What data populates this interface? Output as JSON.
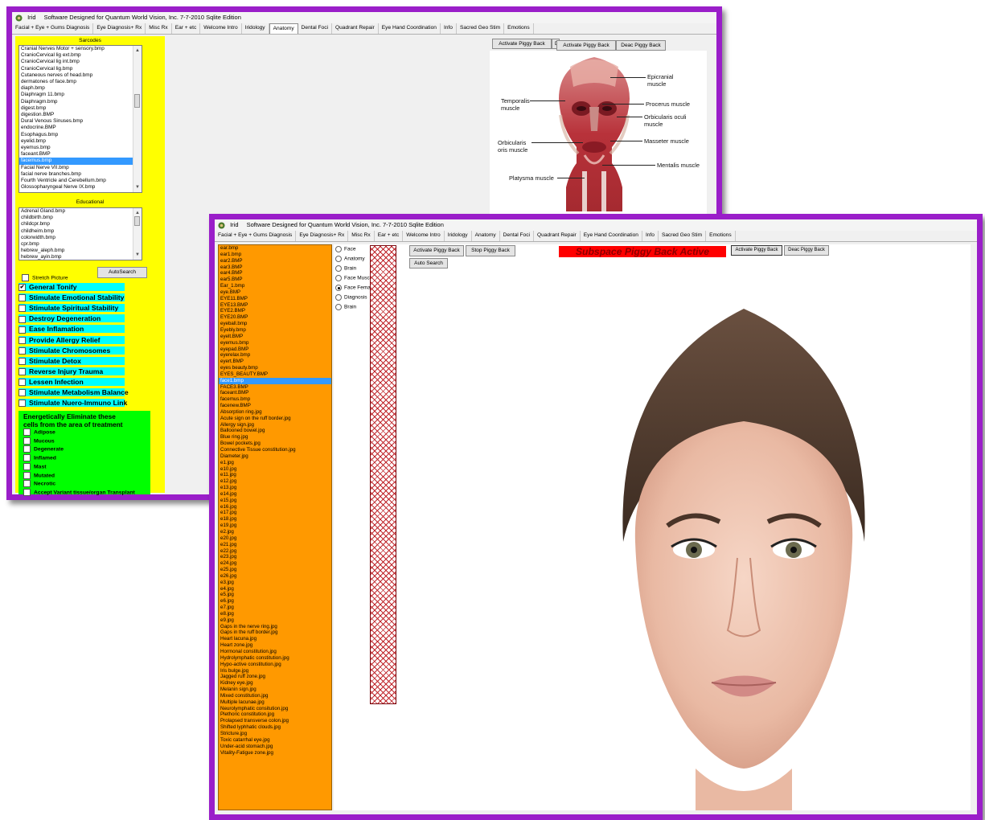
{
  "win1": {
    "title": "Software Designed for Quantum World Vision, Inc. 7-7-2010 Sqlite Edition",
    "app": "Irid",
    "tabs": [
      "Facial + Eye + Gums Diagnosis",
      "Eye Diagnosis+ Rx",
      "Misc Rx",
      "Ear + etc",
      "Welcome Intro",
      "Iridology",
      "Anatomy",
      "Dental Foci",
      "Quadrant Repair",
      "Eye Hand Coordination",
      "Info",
      "Sacred Geo Stim",
      "Emotions"
    ],
    "active_tab": "Anatomy",
    "sarcodes_label": "Sarcodes",
    "sarcodes": [
      "Cranial Nerves Motor + sensory.bmp",
      "CranioCervical lig ext.bmp",
      "CranioCervical lig int.bmp",
      "CranioCervical lig.bmp",
      "Cutaneous nerves of head.bmp",
      "dermatones of face.bmp",
      "diaph.bmp",
      "Diaphragm 11.bmp",
      "Diaphragm.bmp",
      "digest.bmp",
      "digestion.BMP",
      "Dural Venous Sinuses.bmp",
      "endocrine.BMP",
      "Esophagus.bmp",
      "eyelid.bmp",
      "eyemus.bmp",
      "faceant.BMP",
      "facemus.bmp",
      "Facial Nerve  VII.bmp",
      "facial nerve branches.bmp",
      "Fourth Ventricle and Cerebellum.bmp",
      "Glossopharyngeal Nerve  IX.bmp"
    ],
    "sarcodes_selected": "facemus.bmp",
    "educational_label": "Educational",
    "educational": [
      "Adrenal Gland.bmp",
      "childbirth.bmp",
      "childcpr.bmp",
      "childheim.bmp",
      "colorwidth.bmp",
      "cpr.bmp",
      "hebrew_aleph.bmp",
      "hebrew_ayin.bmp"
    ],
    "autosearch": "AutoSearch",
    "stretch_picture": "Stretch Picture",
    "options": [
      {
        "label": "General Tonify",
        "checked": true
      },
      {
        "label": "Stimulate Emotional Stability",
        "checked": false
      },
      {
        "label": "Stimulate Spiritual Stability",
        "checked": false
      },
      {
        "label": "Destroy Degeneration",
        "checked": false
      },
      {
        "label": "Ease Inflamation",
        "checked": false
      },
      {
        "label": "Provide Allergy Relief",
        "checked": false
      },
      {
        "label": "Stimulate Chromosomes",
        "checked": false
      },
      {
        "label": "Stimulate Detox",
        "checked": false
      },
      {
        "label": "Reverse Injury Trauma",
        "checked": false
      },
      {
        "label": "Lessen Infection",
        "checked": false
      },
      {
        "label": "Stimulate Metabolism Balance",
        "checked": false
      },
      {
        "label": "Stimulate Nuero-Immuno Link",
        "checked": false
      }
    ],
    "eliminate_header_1": "Energetically Eliminate these",
    "eliminate_header_2": "cells from the area of treatment",
    "cells": [
      "Adipose",
      "Mucous",
      "Degenerate",
      "Inflamed",
      "Mast",
      "Mutated",
      "Necrotic",
      "Accept Variant tissue/organ Transplant"
    ],
    "buttons": {
      "activate_back": "Activate Piggy Back",
      "activate_peek": "D",
      "activate_front": "Activate Piggy Back",
      "deac": "Deac Piggy Back"
    },
    "muscle_labels": {
      "epicranial": "Epicranial muscle",
      "temporalis": "Temporalis muscle",
      "procerus": "Procerus muscle",
      "orbicularis_oculi": "Orbicularis oculi muscle",
      "masseter": "Masseter muscle",
      "orbicularis_oris": "Orbicularis oris muscle",
      "mentalis": "Mentalis muscle",
      "platysma": "Platysma muscle"
    }
  },
  "win2": {
    "title": "Software Designed for Quantum World Vision, Inc. 7-7-2010 Sqlite Edition",
    "app": "Irid",
    "tabs": [
      "Facial + Eye + Gums Diagnosis",
      "Eye Diagnosis+ Rx",
      "Misc Rx",
      "Ear + etc",
      "Welcome Intro",
      "Iridology",
      "Anatomy",
      "Dental Foci",
      "Quadrant Repair",
      "Eye Hand Coordination",
      "Info",
      "Sacred Geo Stim",
      "Emotions"
    ],
    "files": [
      "ear.bmp",
      "ear1.bmp",
      "ear2.BMP",
      "ear3.BMP",
      "ear4.BMP",
      "ear5.BMP",
      "Ear_1.bmp",
      "eye.BMP",
      "EYE11.BMP",
      "EYE13.BMP",
      "EYE2.BMP",
      "EYE20.BMP",
      "eyeball.bmp",
      "Eyebly.bmp",
      "eyelt.BMP",
      "eyemus.bmp",
      "eyepad.BMP",
      "eyerelax.bmp",
      "eyert.BMP",
      "eyes beauty.bmp",
      "EYES_BEAUTY.BMP",
      "face1.bmp",
      "FACE3.BMP",
      "faceant.BMP",
      "facemus.bmp",
      "facenew.BMP",
      "Absorption ring.jpg",
      "Acute sign on the ruff border.jpg",
      "Allergy sign.jpg",
      "Ballooned bowel.jpg",
      "Blue ring.jpg",
      "Bowel pockets.jpg",
      "Connective Tissue constitution.jpg",
      "Diameter.jpg",
      "e1.jpg",
      "e10.jpg",
      "e11.jpg",
      "e12.jpg",
      "e13.jpg",
      "e14.jpg",
      "e15.jpg",
      "e16.jpg",
      "e17.jpg",
      "e18.jpg",
      "e19.jpg",
      "e2.jpg",
      "e20.jpg",
      "e21.jpg",
      "e22.jpg",
      "e23.jpg",
      "e24.jpg",
      "e25.jpg",
      "e26.jpg",
      "e3.jpg",
      "e4.jpg",
      "e5.jpg",
      "e6.jpg",
      "e7.jpg",
      "e8.jpg",
      "e9.jpg",
      "Gaps in the nerve ring.jpg",
      "Gaps in the ruff border.jpg",
      "Heart lacuna.jpg",
      "Heart zone.jpg",
      "Hormonal constitution.jpg",
      "Hydrolymphatic constitution.jpg",
      "Hypo-active constitution.jpg",
      "Iris bulge.jpg",
      "Jagged ruff zone.jpg",
      "Kidney eye.jpg",
      "Melanin sign.jpg",
      "Mixed constitution.jpg",
      "Multiple lacunae.jpg",
      "Neurolymphatic consitution.jpg",
      "Plethoric constitution.jpg",
      "Prolapsed transverse colon.jpg",
      "Shifted lyphhatic clouds.jpg",
      "Stricture.jpg",
      "Toxic catarrhal eye.jpg",
      "Under-acid stomach.jpg",
      "Vitality-Fatigue zone.jpg"
    ],
    "files_selected": "face1.bmp",
    "radios": [
      {
        "label": "Face",
        "checked": false
      },
      {
        "label": "Anatomy",
        "checked": false
      },
      {
        "label": "Brain",
        "checked": false
      },
      {
        "label": "Face Muscles",
        "checked": false
      },
      {
        "label": "Face Female",
        "checked": true
      },
      {
        "label": "Diagnosis",
        "checked": false
      },
      {
        "label": "Brain",
        "checked": false
      }
    ],
    "buttons": {
      "activate": "Activate Piggy Back",
      "stop": "Stop Piggy Back",
      "auto_search": "Auto Search",
      "activate_small": "Activate Piggy Back",
      "deac": "Deac Piggy Back"
    },
    "status": "Subspace Piggy Back Active"
  },
  "colors": {
    "frame": "#9a1ec9",
    "sidebar_yellow": "#ffff00",
    "option_cyan": "#00ffff",
    "cells_green": "#00ff00",
    "file_orange": "#ff9900",
    "status_red": "#ff0000",
    "hatch_red": "#c0282d"
  },
  "icons": [
    "app-icon",
    "chevron-up-icon",
    "chevron-down-icon",
    "checkmark-icon"
  ]
}
